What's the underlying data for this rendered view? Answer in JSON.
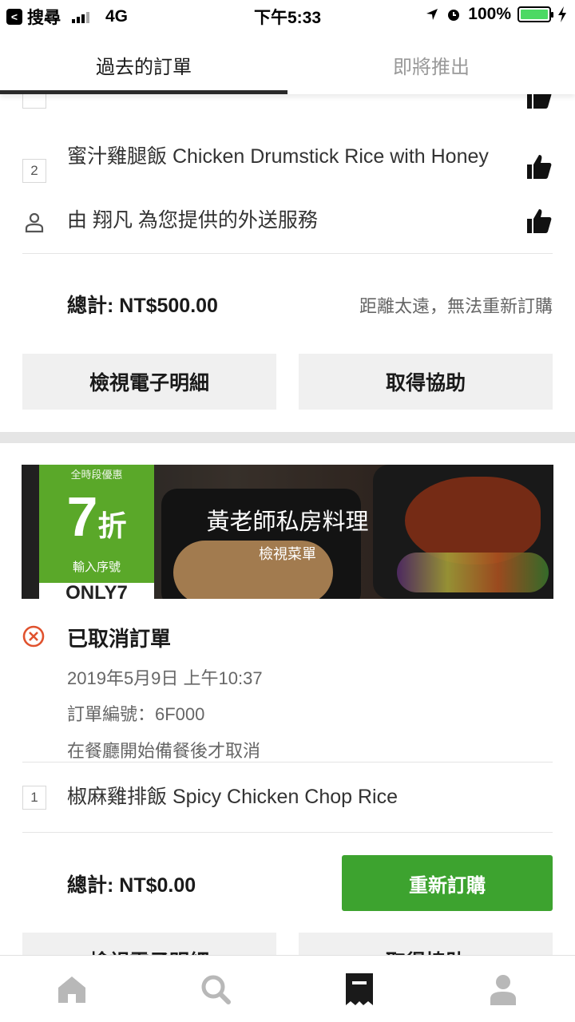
{
  "status_bar": {
    "back_label": "<",
    "carrier": "搜尋",
    "network": "4G",
    "time": "下午5:33",
    "battery": "100%"
  },
  "tabs": [
    {
      "label": "過去的訂單",
      "active": true
    },
    {
      "label": "即將推出",
      "active": false
    }
  ],
  "order1": {
    "items": [
      {
        "qty": "2",
        "name": "蜜汁雞腿飯 Chicken Drumstick Rice with Honey"
      }
    ],
    "courier_text": "由 翔凡 為您提供的外送服務",
    "total": "總計: NT$500.00",
    "reorder_note": "距離太遠，無法重新訂購",
    "receipt_button": "檢視電子明細",
    "help_button": "取得協助"
  },
  "order2": {
    "banner": {
      "restaurant": "黃老師私房料理",
      "view_menu": "檢視菜單",
      "promo_top": "全時段優惠",
      "promo_discount": "7",
      "promo_unit": "折",
      "promo_sub": "輸入序號",
      "promo_code": "ONLY7"
    },
    "status": "已取消訂單",
    "date": "2019年5月9日 上午10:37",
    "order_number": "訂單編號：6F000",
    "cancel_reason": "在餐廳開始備餐後才取消",
    "items": [
      {
        "qty": "1",
        "name": "椒麻雞排飯 Spicy Chicken Chop Rice"
      }
    ],
    "total": "總計: NT$0.00",
    "reorder_button": "重新訂購",
    "receipt_button": "檢視電子明細",
    "help_button": "取得協助"
  },
  "colors": {
    "accent_green": "#3da32f",
    "cancel_red": "#e0522e"
  },
  "bottom_nav": [
    {
      "icon": "home-icon"
    },
    {
      "icon": "search-icon"
    },
    {
      "icon": "orders-icon",
      "active": true
    },
    {
      "icon": "account-icon"
    }
  ]
}
